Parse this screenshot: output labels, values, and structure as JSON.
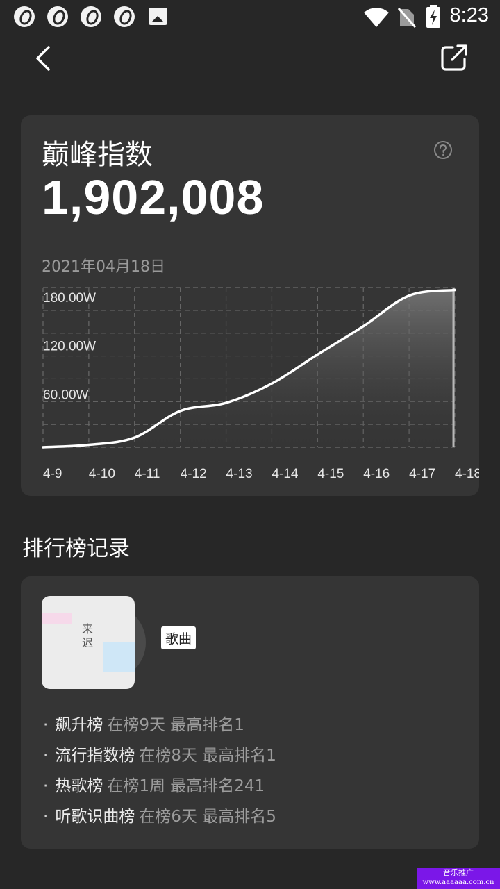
{
  "status_bar": {
    "time": "8:23",
    "left_icons": [
      "app-icon",
      "app-icon",
      "app-icon",
      "app-icon",
      "image-icon"
    ],
    "right_icons": [
      "wifi-icon",
      "no-sim-icon",
      "battery-charging-icon"
    ]
  },
  "header": {
    "back_icon": "chevron-left-icon",
    "share_icon": "share-external-icon"
  },
  "peak_card": {
    "title": "巅峰指数",
    "value": "1,902,008",
    "help_icon": "question-circle-icon",
    "date": "2021年04月18日"
  },
  "chart_data": {
    "type": "area",
    "x": [
      "4-9",
      "4-10",
      "4-11",
      "4-12",
      "4-13",
      "4-14",
      "4-15",
      "4-16",
      "4-17",
      "4-18"
    ],
    "y_ticks": [
      "60.00W",
      "120.00W",
      "180.00W"
    ],
    "y_tick_values": [
      60,
      120,
      180
    ],
    "ylim": [
      0,
      198
    ],
    "points": [
      {
        "x": "4-9",
        "y": 0
      },
      {
        "x": "4-10",
        "y": 3
      },
      {
        "x": "4-11",
        "y": 12
      },
      {
        "x": "4-12",
        "y": 45
      },
      {
        "x": "4-13",
        "y": 55
      },
      {
        "x": "4-14",
        "y": 79
      },
      {
        "x": "4-15",
        "y": 115
      },
      {
        "x": "4-16",
        "y": 150
      },
      {
        "x": "4-17",
        "y": 188
      },
      {
        "x": "4-18",
        "y": 195
      }
    ],
    "highlight_x": "4-17",
    "line_color": "#ffffff",
    "grid": true
  },
  "ranking": {
    "section_title": "排行榜记录",
    "badge": "歌曲",
    "cover_text": "来迟",
    "items": [
      {
        "name": "飙升榜",
        "detail": "在榜9天 最高排名1"
      },
      {
        "name": "流行指数榜",
        "detail": "在榜8天 最高排名1"
      },
      {
        "name": "热歌榜",
        "detail": "在榜1周 最高排名241"
      },
      {
        "name": "听歌识曲榜",
        "detail": "在榜6天 最高排名5"
      }
    ]
  },
  "watermark": {
    "line1": "音乐推广",
    "line2": "www.aaaaaa.com.cn"
  }
}
